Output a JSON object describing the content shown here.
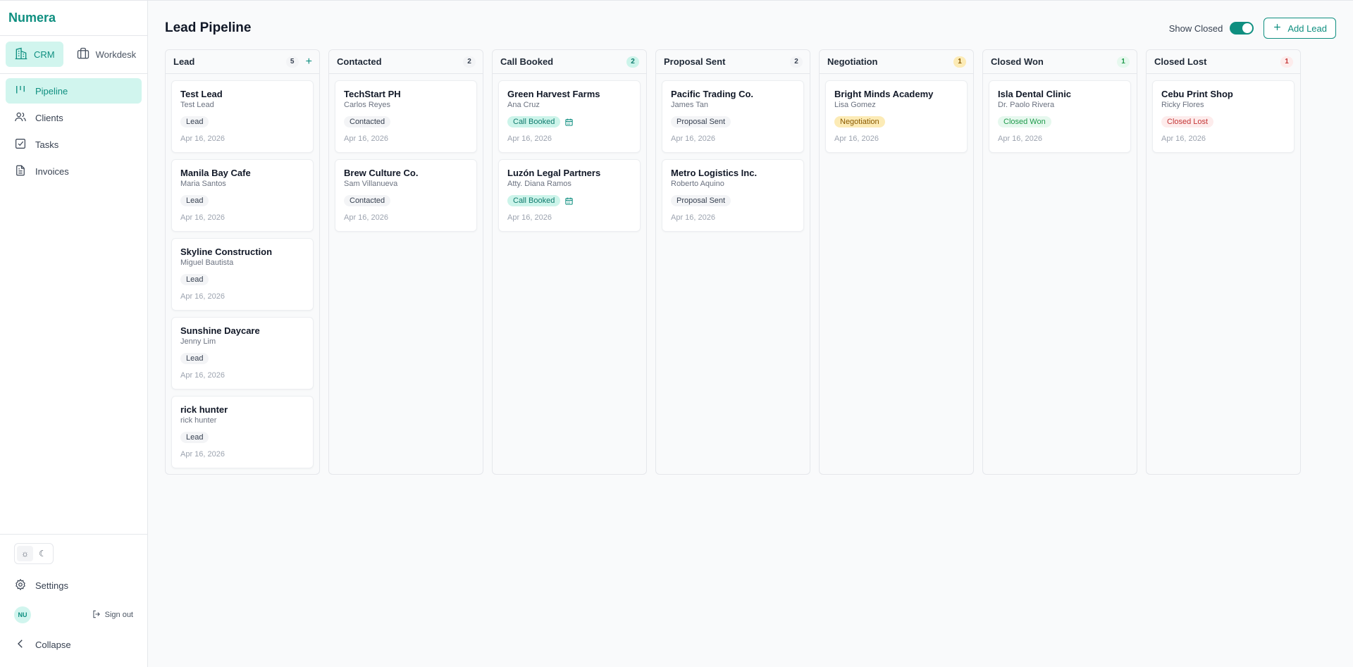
{
  "brand": "Numera",
  "switcher": [
    {
      "label": "CRM",
      "icon": "building-icon",
      "active": true
    },
    {
      "label": "Workdesk",
      "icon": "briefcase-icon",
      "active": false
    }
  ],
  "nav": [
    {
      "label": "Pipeline",
      "icon": "pipeline-icon",
      "active": true
    },
    {
      "label": "Clients",
      "icon": "users-icon",
      "active": false
    },
    {
      "label": "Tasks",
      "icon": "checkbox-icon",
      "active": false
    },
    {
      "label": "Invoices",
      "icon": "document-icon",
      "active": false
    }
  ],
  "bottom": {
    "settings": "Settings",
    "user_initials": "NU",
    "signout": "Sign out",
    "collapse": "Collapse"
  },
  "header": {
    "title": "Lead Pipeline",
    "show_closed": "Show Closed",
    "show_closed_on": true,
    "add_lead": "Add Lead"
  },
  "colors": {
    "accent": "#0f8f80",
    "accent_light": "#d1f5ee"
  },
  "columns": [
    {
      "name": "Lead",
      "count": "5",
      "count_style": "neutral",
      "has_add": true,
      "cards": [
        {
          "title": "Test Lead",
          "contact": "Test Lead",
          "tag": "Lead",
          "tag_style": "neutral",
          "date": "Apr 16, 2026"
        },
        {
          "title": "Manila Bay Cafe",
          "contact": "Maria Santos",
          "tag": "Lead",
          "tag_style": "neutral",
          "date": "Apr 16, 2026"
        },
        {
          "title": "Skyline Construction",
          "contact": "Miguel Bautista",
          "tag": "Lead",
          "tag_style": "neutral",
          "date": "Apr 16, 2026"
        },
        {
          "title": "Sunshine Daycare",
          "contact": "Jenny Lim",
          "tag": "Lead",
          "tag_style": "neutral",
          "date": "Apr 16, 2026"
        },
        {
          "title": "rick hunter",
          "contact": "rick hunter",
          "tag": "Lead",
          "tag_style": "neutral",
          "date": "Apr 16, 2026"
        }
      ]
    },
    {
      "name": "Contacted",
      "count": "2",
      "count_style": "neutral",
      "has_add": false,
      "cards": [
        {
          "title": "TechStart PH",
          "contact": "Carlos Reyes",
          "tag": "Contacted",
          "tag_style": "neutral",
          "date": "Apr 16, 2026"
        },
        {
          "title": "Brew Culture Co.",
          "contact": "Sam Villanueva",
          "tag": "Contacted",
          "tag_style": "neutral",
          "date": "Apr 16, 2026"
        }
      ]
    },
    {
      "name": "Call Booked",
      "count": "2",
      "count_style": "teal",
      "has_add": false,
      "cards": [
        {
          "title": "Green Harvest Farms",
          "contact": "Ana Cruz",
          "tag": "Call Booked",
          "tag_style": "booked",
          "date": "Apr 16, 2026",
          "calendar": true
        },
        {
          "title": "Luzón Legal Partners",
          "contact": "Atty. Diana Ramos",
          "tag": "Call Booked",
          "tag_style": "booked",
          "date": "Apr 16, 2026",
          "calendar": true
        }
      ]
    },
    {
      "name": "Proposal Sent",
      "count": "2",
      "count_style": "neutral",
      "has_add": false,
      "cards": [
        {
          "title": "Pacific Trading Co.",
          "contact": "James Tan",
          "tag": "Proposal Sent",
          "tag_style": "neutral",
          "date": "Apr 16, 2026"
        },
        {
          "title": "Metro Logistics Inc.",
          "contact": "Roberto Aquino",
          "tag": "Proposal Sent",
          "tag_style": "neutral",
          "date": "Apr 16, 2026"
        }
      ]
    },
    {
      "name": "Negotiation",
      "count": "1",
      "count_style": "amber",
      "has_add": false,
      "cards": [
        {
          "title": "Bright Minds Academy",
          "contact": "Lisa Gomez",
          "tag": "Negotiation",
          "tag_style": "nego",
          "date": "Apr 16, 2026"
        }
      ]
    },
    {
      "name": "Closed Won",
      "count": "1",
      "count_style": "green",
      "has_add": false,
      "cards": [
        {
          "title": "Isla Dental Clinic",
          "contact": "Dr. Paolo Rivera",
          "tag": "Closed Won",
          "tag_style": "won",
          "date": "Apr 16, 2026"
        }
      ]
    },
    {
      "name": "Closed Lost",
      "count": "1",
      "count_style": "red",
      "has_add": false,
      "cards": [
        {
          "title": "Cebu Print Shop",
          "contact": "Ricky Flores",
          "tag": "Closed Lost",
          "tag_style": "lost",
          "date": "Apr 16, 2026"
        }
      ]
    }
  ]
}
